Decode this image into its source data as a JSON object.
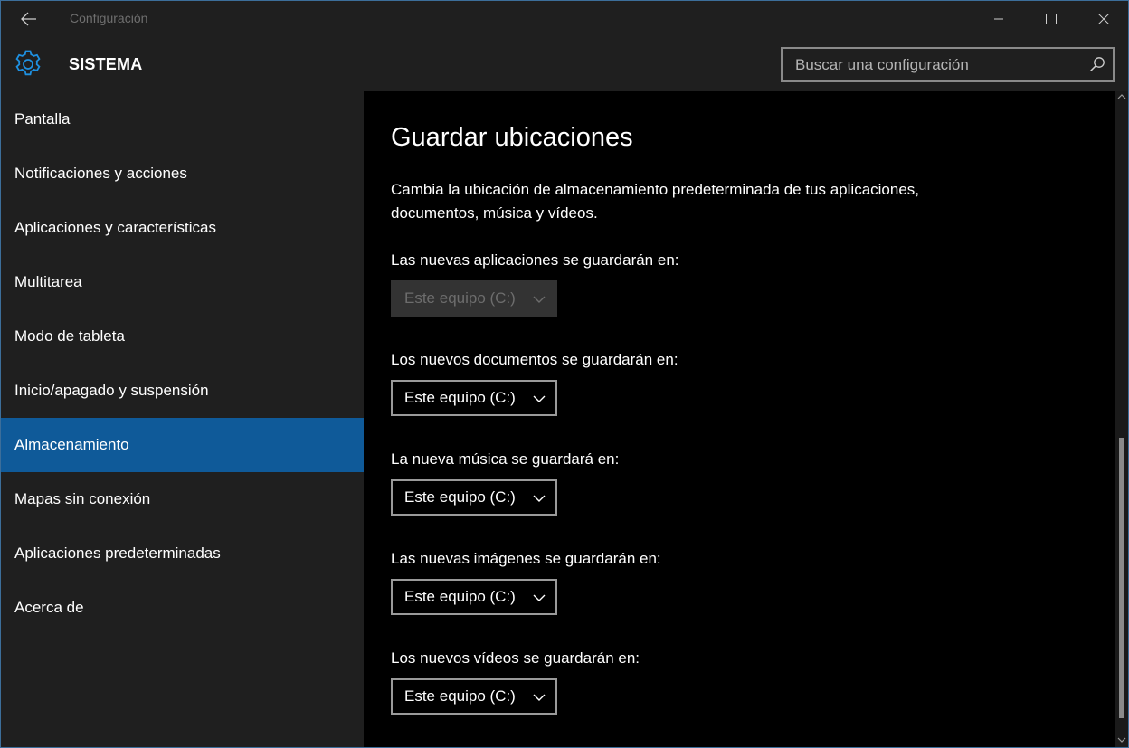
{
  "window": {
    "title": "Configuración"
  },
  "header": {
    "title": "SISTEMA"
  },
  "search": {
    "placeholder": "Buscar una configuración"
  },
  "sidebar": {
    "items": [
      {
        "label": "Pantalla"
      },
      {
        "label": "Notificaciones y acciones"
      },
      {
        "label": "Aplicaciones y características"
      },
      {
        "label": "Multitarea"
      },
      {
        "label": "Modo de tableta"
      },
      {
        "label": "Inicio/apagado y suspensión"
      },
      {
        "label": "Almacenamiento",
        "active": true
      },
      {
        "label": "Mapas sin conexión"
      },
      {
        "label": "Aplicaciones predeterminadas"
      },
      {
        "label": "Acerca de"
      }
    ]
  },
  "main": {
    "title": "Guardar ubicaciones",
    "description": "Cambia la ubicación de almacenamiento predeterminada de tus aplicaciones, documentos, música y vídeos.",
    "settings": [
      {
        "label": "Las nuevas aplicaciones se guardarán en:",
        "value": "Este equipo (C:)",
        "disabled": true
      },
      {
        "label": "Los nuevos documentos se guardarán en:",
        "value": "Este equipo (C:)"
      },
      {
        "label": "La nueva música se guardará en:",
        "value": "Este equipo (C:)"
      },
      {
        "label": "Las nuevas imágenes se guardarán en:",
        "value": "Este equipo (C:)"
      },
      {
        "label": "Los nuevos vídeos se guardarán en:",
        "value": "Este equipo (C:)"
      }
    ]
  },
  "icons": {
    "back": "back-arrow-icon",
    "minimize": "minimize-icon",
    "maximize": "maximize-icon",
    "close": "close-icon",
    "header": "gear-icon",
    "search": "search-icon",
    "dropdown": "chevron-down-icon"
  },
  "colors": {
    "accent": "#0f5a99",
    "gear": "#1e90e0",
    "chrome": "#1f1f1f",
    "content_bg": "#000000"
  }
}
